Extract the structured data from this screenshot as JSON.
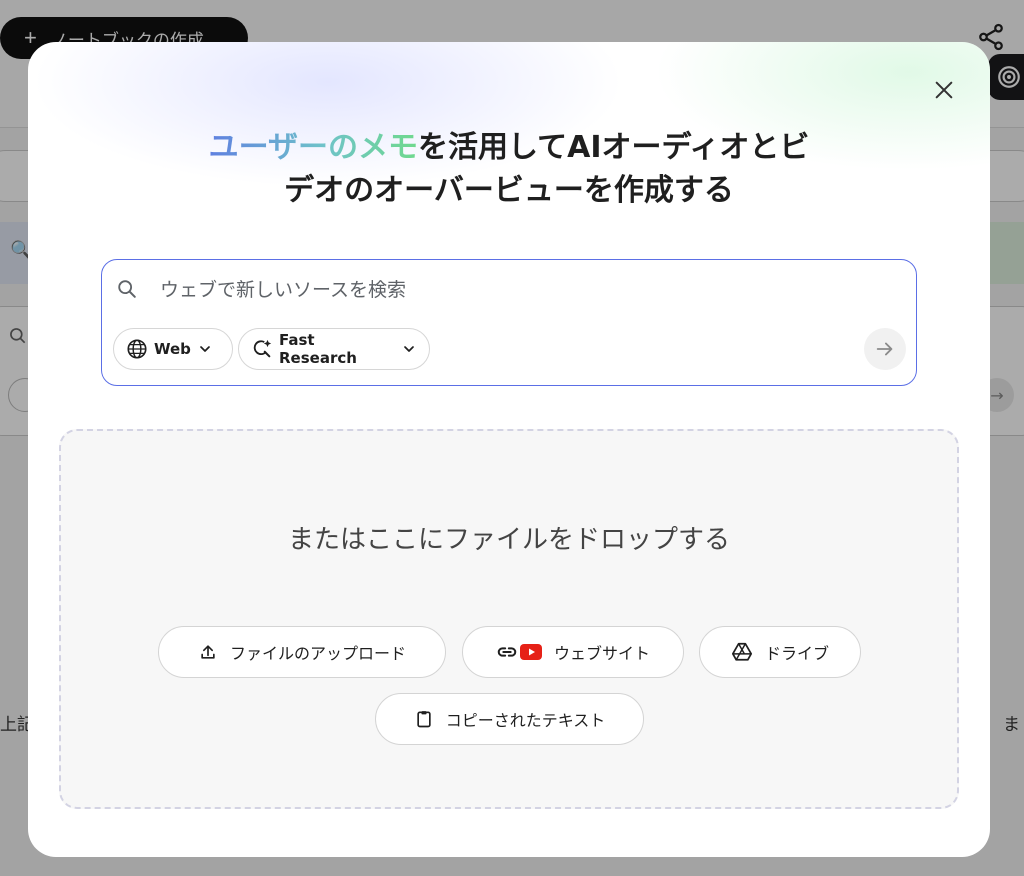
{
  "background": {
    "create_notebook_label": "ノートブックの作成",
    "create_notebook_plus": "+",
    "left_fragment": "上記",
    "right_fragment": "ま"
  },
  "modal": {
    "headline": {
      "highlight": "ユーザーのメモ",
      "rest_line1": "を活用してAIオーディオとビ",
      "line2": "デオのオーバービューを作成する"
    },
    "search": {
      "placeholder": "ウェブで新しいソースを検索",
      "value": "",
      "source_chip": "Web",
      "mode_chip": "Fast Research"
    },
    "dropzone": {
      "title": "またはここにファイルをドロップする",
      "buttons": {
        "upload": "ファイルのアップロード",
        "website": "ウェブサイト",
        "drive": "ドライブ",
        "copied_text": "コピーされたテキスト"
      }
    }
  },
  "colors": {
    "accent_border": "#5b6fe6",
    "youtube_red": "#e62117",
    "gradient_start": "#5f80e0",
    "gradient_end": "#6fd98d"
  },
  "icons": {
    "close": "close-icon",
    "search": "search-icon",
    "globe": "globe-icon",
    "research": "sparkle-search-icon",
    "submit": "arrow-right-icon",
    "upload": "upload-icon",
    "link": "link-icon",
    "youtube": "youtube-icon",
    "drive": "drive-icon",
    "clipboard": "clipboard-icon",
    "share": "share-icon"
  }
}
